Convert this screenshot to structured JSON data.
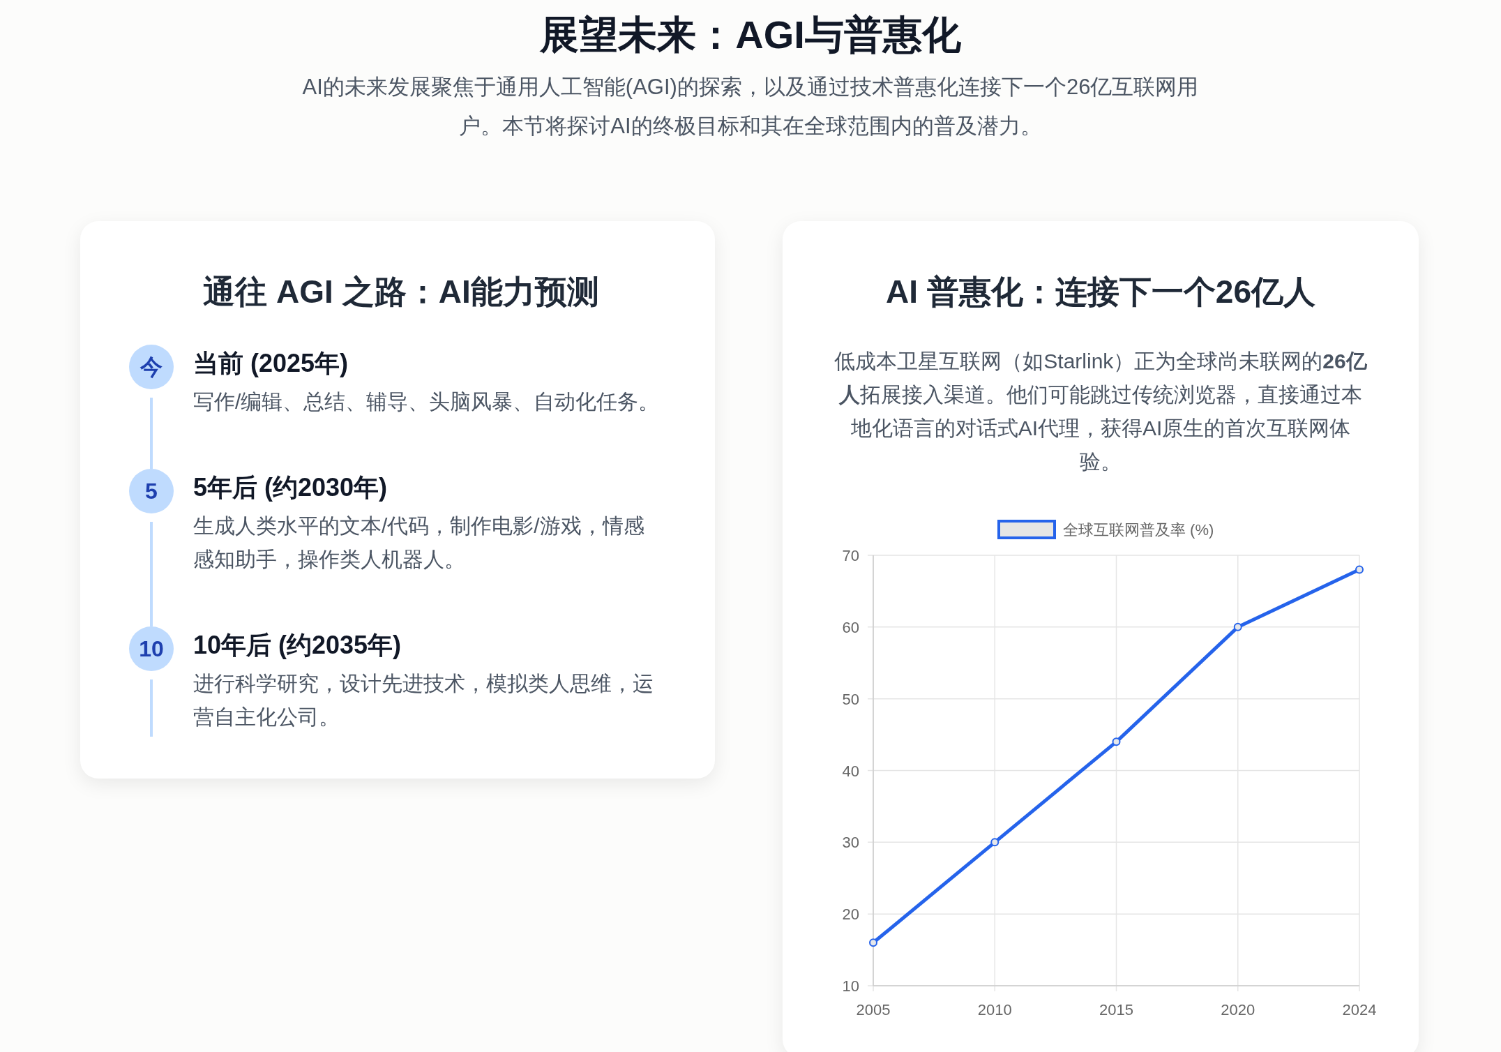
{
  "header": {
    "title": "展望未来：AGI与普惠化",
    "subtitle": "AI的未来发展聚焦于通用人工智能(AGI)的探索，以及通过技术普惠化连接下一个26亿互联网用户。本节将探讨AI的终极目标和其在全球范围内的普及潜力。"
  },
  "agi_card": {
    "title": "通往 AGI 之路：AI能力预测",
    "timeline": [
      {
        "marker": "今",
        "heading": "当前 (2025年)",
        "text": "写作/编辑、总结、辅导、头脑风暴、自动化任务。"
      },
      {
        "marker": "5",
        "heading": "5年后 (约2030年)",
        "text": "生成人类水平的文本/代码，制作电影/游戏，情感感知助手，操作类人机器人。"
      },
      {
        "marker": "10",
        "heading": "10年后 (约2035年)",
        "text": "进行科学研究，设计先进技术，模拟类人思维，运营自主化公司。"
      }
    ]
  },
  "inclusion_card": {
    "title": "AI 普惠化：连接下一个26亿人",
    "text": "低成本卫星互联网（如Starlink）正为全球尚未联网的**26亿人**拓展接入渠道。他们可能跳过传统浏览器，直接通过本地化语言的对话式AI代理，获得AI原生的首次互联网体验。",
    "chart_data": {
      "type": "line",
      "categories": [
        "2005",
        "2010",
        "2015",
        "2020",
        "2024"
      ],
      "series": [
        {
          "name": "全球互联网普及率 (%)",
          "color": "#2563eb",
          "marker": true,
          "values": [
            16,
            30,
            44,
            60,
            68
          ]
        }
      ],
      "grid": true,
      "ylim": [
        10,
        70
      ],
      "yticks": [
        10,
        20,
        30,
        40,
        50,
        60,
        70
      ]
    }
  }
}
